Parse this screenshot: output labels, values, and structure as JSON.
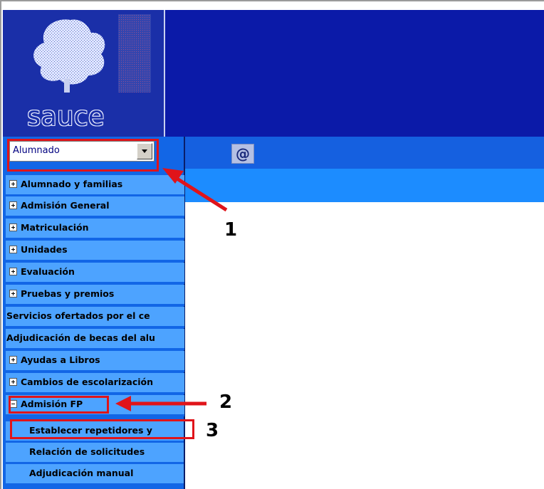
{
  "app": {
    "logo_text": "sauce"
  },
  "profile_select": {
    "value": "Alumnado"
  },
  "toolbar": {
    "email_icon_glyph": "@"
  },
  "menu": [
    {
      "label": "Alumnado y familias",
      "icon": "plus-box-icon"
    },
    {
      "label": "Admisión General",
      "icon": "plus-box-icon"
    },
    {
      "label": "Matriculación",
      "icon": "plus-box-icon"
    },
    {
      "label": "Unidades",
      "icon": "plus-box-icon"
    },
    {
      "label": "Evaluación",
      "icon": "plus-box-icon"
    },
    {
      "label": "Pruebas y premios",
      "icon": "plus-box-icon"
    },
    {
      "label": "Servicios ofertados por el ce",
      "icon": ""
    },
    {
      "label": "Adjudicación de becas del alu",
      "icon": ""
    },
    {
      "label": "Ayudas a Libros",
      "icon": "plus-box-icon"
    },
    {
      "label": "Cambios de escolarización",
      "icon": "plus-box-icon"
    },
    {
      "label": "Admisión FP",
      "icon": "minus-box-icon"
    }
  ],
  "submenu": [
    {
      "label": "Establecer repetidores y"
    },
    {
      "label": "Relación de solicitudes"
    },
    {
      "label": "Adjudicación manual"
    }
  ],
  "annotations": {
    "callout_1": "1",
    "callout_2": "2",
    "callout_3": "3",
    "highlight_color": "#e0141a"
  },
  "colors": {
    "header_blue": "#0b1aa8",
    "toolbar_blue": "#1560e0",
    "menu_item_bg": "#4da3ff"
  }
}
